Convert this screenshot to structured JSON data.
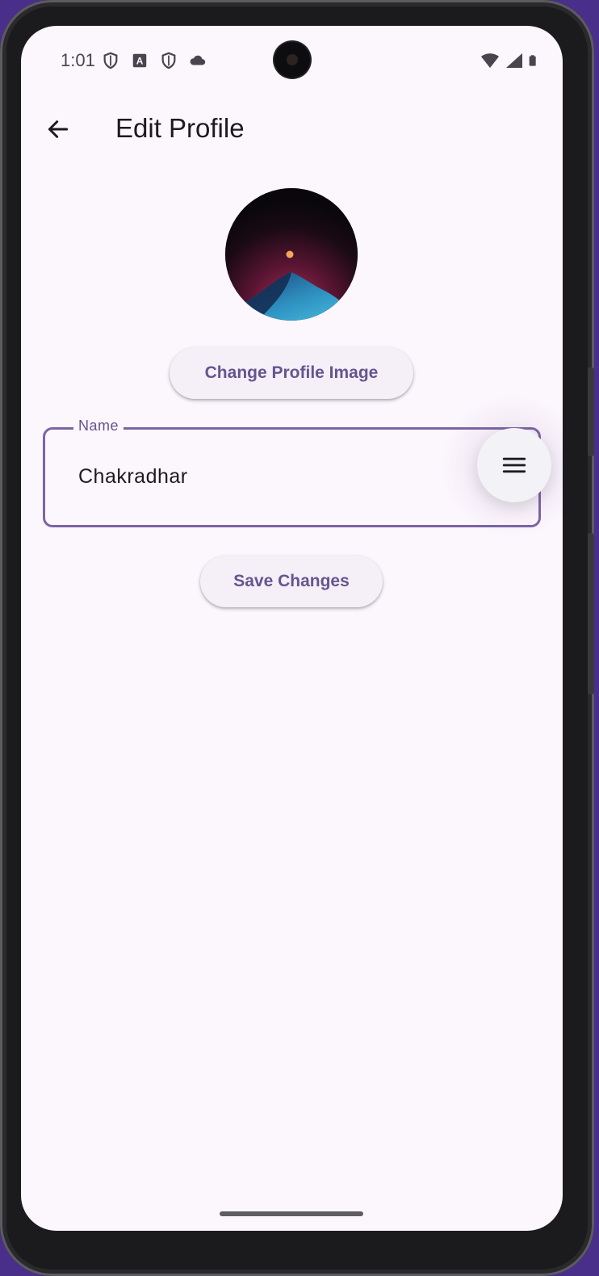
{
  "status_bar": {
    "time": "1:01",
    "left_icons": [
      "shield-icon",
      "text-a-icon",
      "shield-icon",
      "cloud-icon"
    ],
    "right_icons": [
      "wifi-icon",
      "signal-icon",
      "battery-icon"
    ]
  },
  "app_bar": {
    "back_icon": "arrow-back-icon",
    "title": "Edit Profile"
  },
  "profile": {
    "avatar_description": "profile-image",
    "change_image_label": "Change Profile Image"
  },
  "form": {
    "name_label": "Name",
    "name_value": "Chakradhar"
  },
  "actions": {
    "save_label": "Save Changes",
    "menu_icon": "menu-icon"
  },
  "colors": {
    "accent": "#65558f",
    "background": "#fcf6fd",
    "field_border": "#7b64a6",
    "button_bg": "#f5eff7"
  }
}
